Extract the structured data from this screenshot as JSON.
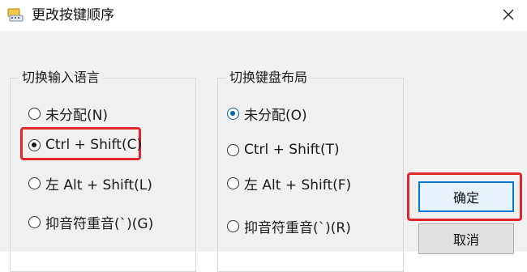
{
  "window": {
    "title": "更改按键顺序"
  },
  "icons": {
    "app": "keyboard-app-icon",
    "close": "close-icon"
  },
  "input_language_group": {
    "title": "切换输入语言",
    "options": [
      {
        "label": "未分配(N)",
        "checked": false
      },
      {
        "label": "Ctrl + Shift(C)",
        "checked": true,
        "highlighted": true
      },
      {
        "label": "左 Alt + Shift(L)",
        "checked": false
      },
      {
        "label": "抑音符重音(`)(G)",
        "checked": false
      }
    ]
  },
  "keyboard_layout_group": {
    "title": "切换键盘布局",
    "options": [
      {
        "label": "未分配(O)",
        "checked": true
      },
      {
        "label": "Ctrl + Shift(T)",
        "checked": false
      },
      {
        "label": "左 Alt + Shift(F)",
        "checked": false
      },
      {
        "label": "抑音符重音(`)(R)",
        "checked": false
      }
    ]
  },
  "buttons": {
    "ok": "确定",
    "cancel": "取消"
  },
  "colors": {
    "highlight": "#e3282b",
    "accent": "#0078d7",
    "client_bg": "#f0f0f0"
  }
}
